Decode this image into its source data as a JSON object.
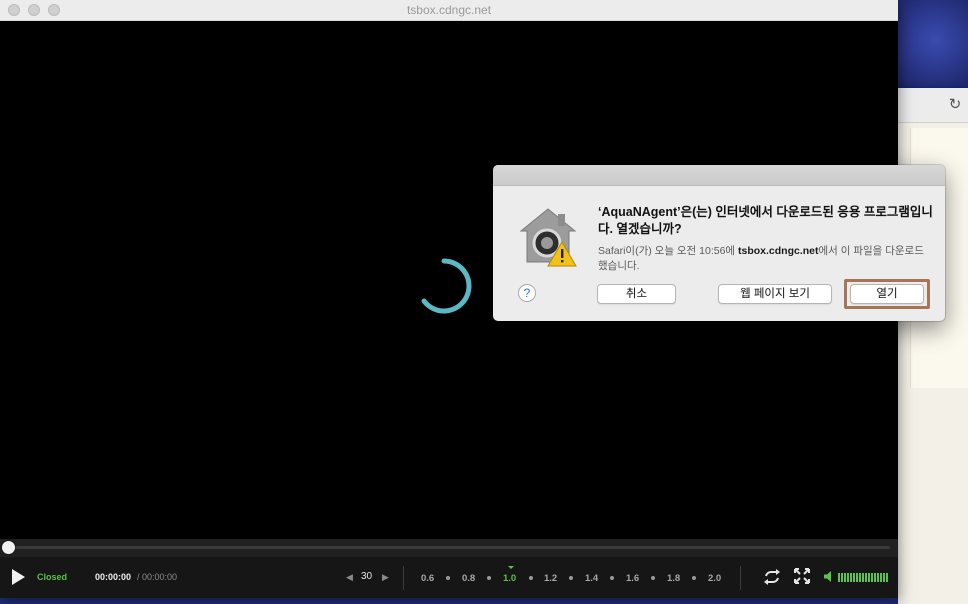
{
  "window": {
    "title": "tsbox.cdngc.net"
  },
  "player": {
    "status": "Closed",
    "time_current": "00:00:00",
    "time_separator_total": "/ 00:00:00",
    "skip_seconds": "30",
    "speeds": [
      "0.6",
      "0.8",
      "1.0",
      "1.2",
      "1.4",
      "1.6",
      "1.8",
      "2.0"
    ],
    "active_speed": "1.0",
    "progress": 0,
    "colors": {
      "accent_green": "#5bc24a",
      "spinner": "#5bb8c5"
    }
  },
  "dialog": {
    "title": "‘AquaNAgent’은(는) 인터넷에서 다운로드된 응용 프로그램입니다. 열겠습니까?",
    "message_prefix": "Safari이(가) 오늘 오전 10:56에 ",
    "message_host": "tsbox.cdngc.net",
    "message_suffix": "에서 이 파일을 다운로드했습니다.",
    "help_label": "?",
    "cancel_label": "취소",
    "view_web_label": "웹 페이지 보기",
    "open_label": "열기",
    "highlight_color": "#a87456"
  }
}
